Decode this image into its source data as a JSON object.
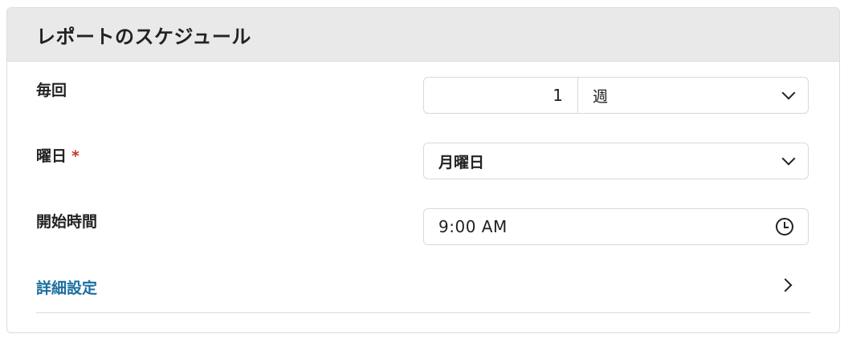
{
  "header": {
    "title": "レポートのスケジュール"
  },
  "frequency": {
    "label": "毎回",
    "count": "1",
    "unit": "週"
  },
  "weekday": {
    "label": "曜日",
    "required_mark": "*",
    "value": "月曜日"
  },
  "start_time": {
    "label": "開始時間",
    "value": "9:00 AM"
  },
  "advanced": {
    "label": "詳細設定"
  },
  "icons": {
    "frequency_dropdown": "chevron-down-icon",
    "weekday_dropdown": "chevron-down-icon",
    "time_picker": "clock-icon",
    "advanced_expand": "chevron-right-icon"
  },
  "colors": {
    "link": "#1a6fa0",
    "required": "#c0392b",
    "header_bg": "#e9e9e9"
  }
}
